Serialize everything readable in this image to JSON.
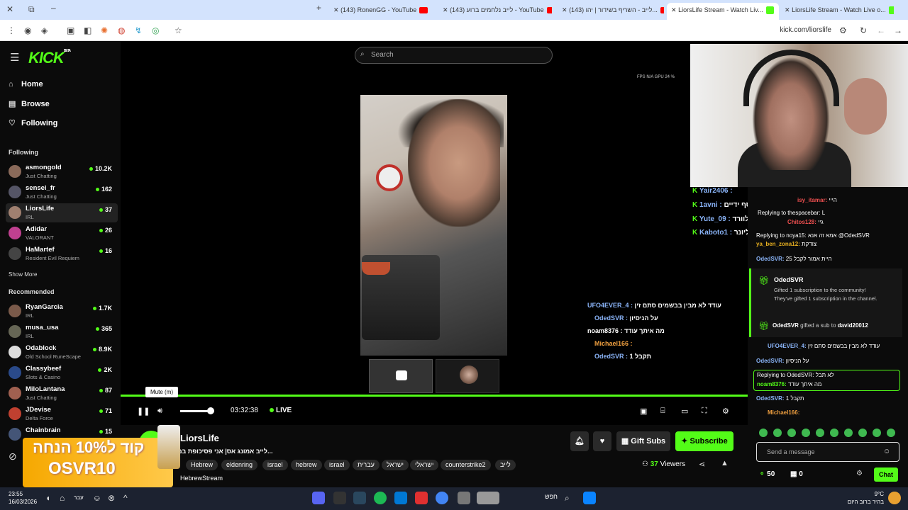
{
  "browser": {
    "tabs": [
      {
        "title": "(143) RonenGG - YouTube",
        "icon": "youtube-icon"
      },
      {
        "title": "(143) לייב נלחמים ברוע - YouTube",
        "icon": "youtube-icon"
      },
      {
        "title": "(143) לייב - השריף בשידור | יהו...",
        "icon": "youtube-icon"
      },
      {
        "title": "LiorsLife Stream - Watch Liv...",
        "icon": "kick-icon",
        "active": true
      },
      {
        "title": "LiorsLife Stream - Watch Live o...",
        "icon": "kick-icon"
      }
    ],
    "url": "kick.com/liorslife"
  },
  "site": {
    "logo": "KICK",
    "logo_beta": "BETA",
    "search_placeholder": "Search"
  },
  "nav": [
    {
      "label": "Home",
      "icon": "home-icon"
    },
    {
      "label": "Browse",
      "icon": "browse-icon"
    },
    {
      "label": "Following",
      "icon": "heart-icon"
    }
  ],
  "following": {
    "title": "Following",
    "channels": [
      {
        "name": "asmongold",
        "category": "Just Chatting",
        "viewers": "10.2K"
      },
      {
        "name": "sensei_fr",
        "category": "Just Chatting",
        "viewers": "162"
      },
      {
        "name": "LiorsLife",
        "category": "IRL",
        "viewers": "37",
        "selected": true
      },
      {
        "name": "Adidar",
        "category": "VALORANT",
        "viewers": "26"
      },
      {
        "name": "HaMartef",
        "category": "Resident Evil Requiem",
        "viewers": "16"
      }
    ],
    "show_more": "Show More"
  },
  "recommended": {
    "title": "Recommended",
    "channels": [
      {
        "name": "RyanGarcia",
        "category": "IRL",
        "viewers": "1.7K"
      },
      {
        "name": "musa_usa",
        "category": "IRL",
        "viewers": "365"
      },
      {
        "name": "Odablock",
        "category": "Old School RuneScape",
        "viewers": "8.9K"
      },
      {
        "name": "Classybeef",
        "category": "Slots & Casino",
        "viewers": "2K"
      },
      {
        "name": "MiloLantana",
        "category": "Just Chatting",
        "viewers": "87"
      },
      {
        "name": "JDevise",
        "category": "Delta Force",
        "viewers": "71"
      },
      {
        "name": "Chainbrain",
        "category": "",
        "viewers": "15"
      }
    ]
  },
  "video": {
    "fps": "FPS N/A   GPU 24 %",
    "overlay_chat": [
      {
        "user": "UFO4EVER_4 :",
        "text": "עודד לא מבין בבשמים סתם זין"
      },
      {
        "user": "OdedSVR :",
        "text": "על הניסיון"
      },
      {
        "user": "noam8376 :",
        "text": "מה איתך עודד"
      },
      {
        "user": "Michael166 :",
        "text": ""
      },
      {
        "user": "OdedSVR :",
        "text": "תקבל 1"
      }
    ],
    "webcam_chat": [
      {
        "user": "Yair2406 :",
        "text": ""
      },
      {
        "user": "1avni :",
        "text": "והחבר שלו בכלל גמור לא שוסף ידיים"
      },
      {
        "user": "Yute_09 :",
        "text": "דאלוורד"
      },
      {
        "user": "Kaboto1 :",
        "text": "א מיליונר"
      }
    ],
    "tooltip": "Mute (m)",
    "time": "03:32:38",
    "live": "LIVE",
    "volume": 0.85
  },
  "stream": {
    "streamer": "LiorsLife",
    "title": "לייב אמונג אס| אני פסיכופת במ...",
    "tags": [
      "Hebrew",
      "eldenring",
      "israel",
      "hebrew",
      "israel",
      "עברית",
      "ישראל",
      "ישראלי",
      "counterstrike2",
      "לייב"
    ],
    "tag_extra": "HebrewStream",
    "viewers_count": "37",
    "viewers_label": "Viewers",
    "gift_subs": "Gift Subs",
    "subscribe": "Subscribe"
  },
  "promo": {
    "line1": "קוד ל10% הנחה",
    "line2": "OSVR10"
  },
  "chat": {
    "lines": [
      {
        "user": "isy_itamar:",
        "text": "הייי",
        "reply": ""
      },
      {
        "user": "",
        "text": "",
        "reply": "Replying to thespacebar: L"
      },
      {
        "user": "Chitos128:",
        "text": "גיי",
        "reply": ""
      },
      {
        "user": "",
        "text": "",
        "reply": "Replying to noya15: אמא זה אנא @OdedSVR"
      },
      {
        "user": "ya_ben_zona12:",
        "text": "צודקת",
        "reply": ""
      },
      {
        "user": "OdedSVR:",
        "text": "היית אמור לקבל 25",
        "reply": ""
      }
    ],
    "gift1": {
      "user": "OdedSVR",
      "line1": "Gifted 1 subscription to the community!",
      "line2": "They've gifted 1 subscription in the channel."
    },
    "gift2": {
      "user": "OdedSVR",
      "mid": "gifted a sub to",
      "target": "david20012"
    },
    "lines2": [
      {
        "user": "UFO4EVER_4:",
        "text": "עודד לא מבין בבשמים סתם זין"
      },
      {
        "user": "OdedSVR:",
        "text": "על הניסיון"
      }
    ],
    "reply_block": {
      "reply": "Replying to OdedSVR: לא תבל",
      "user": "noam8376:",
      "text": "מה איתך עודד"
    },
    "lines3": [
      {
        "user": "OdedSVR:",
        "text": "תקבל 1"
      },
      {
        "user": "Michael166:",
        "text": ""
      }
    ],
    "placeholder": "Send a message",
    "points": "50",
    "gifts": "0",
    "send": "Chat"
  },
  "taskbar": {
    "time": "23:55",
    "date": "16/03/2026",
    "lang": "עבר",
    "search": "חפש",
    "temp": "9°C",
    "weather": "בהיר ברוב היום"
  }
}
